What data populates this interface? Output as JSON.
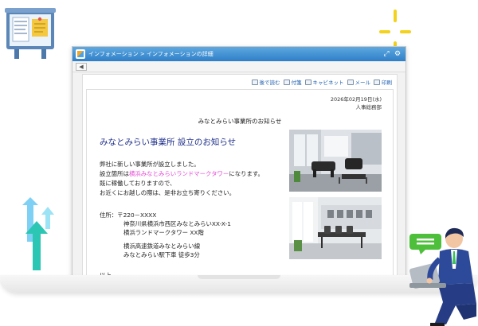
{
  "window": {
    "breadcrumb": "インフォメーション > インフォメーションの詳細",
    "expand_glyph": "⤢",
    "settings_glyph": "⚙",
    "back_glyph": "◀"
  },
  "toolbar": {
    "items": [
      {
        "label": "後で読む",
        "icon": "bookmark-icon"
      },
      {
        "label": "付箋",
        "icon": "sticky-note-icon"
      },
      {
        "label": "キャビネット",
        "icon": "cabinet-icon"
      },
      {
        "label": "メール",
        "icon": "mail-icon"
      },
      {
        "label": "印刷",
        "icon": "print-icon"
      }
    ]
  },
  "notice": {
    "date": "2026年02月19日(水)",
    "department": "人事総務部",
    "title": "みなとみらい事業所のお知らせ",
    "headline": "みなとみらい事業所 設立のお知らせ",
    "body_line1": "弊社に新しい事業所が設立しました。",
    "body_line2_prefix": "設立箇所は",
    "body_line2_highlight": "横浜みなとみらいランドマークタワー",
    "body_line2_suffix": "になります。",
    "body_line3": "既に稼働しておりますので、",
    "body_line4": "お近くにお越しの際は、是非お立ち寄りください。",
    "address_label": "住所：〒220－XXXX",
    "address_line1": "神奈川県横浜市西区みなとみらいXX-X-1",
    "address_line2": "横浜ランドマークタワー XX階",
    "station_line1": "横浜高速鉄道みなとみらい線",
    "station_line2": "みなとみらい駅下車 徒歩3分",
    "closing": "以上"
  },
  "colors": {
    "titlebar": "#3b8fd6",
    "headline": "#1f2f8a",
    "highlight": "#e44ad6",
    "link": "#1d5fae",
    "sparkle": "#f3d21b",
    "arrow_teal": "#2cc6b4",
    "arrow_blue": "#5ab4ee",
    "bubble": "#4dbf3a"
  }
}
